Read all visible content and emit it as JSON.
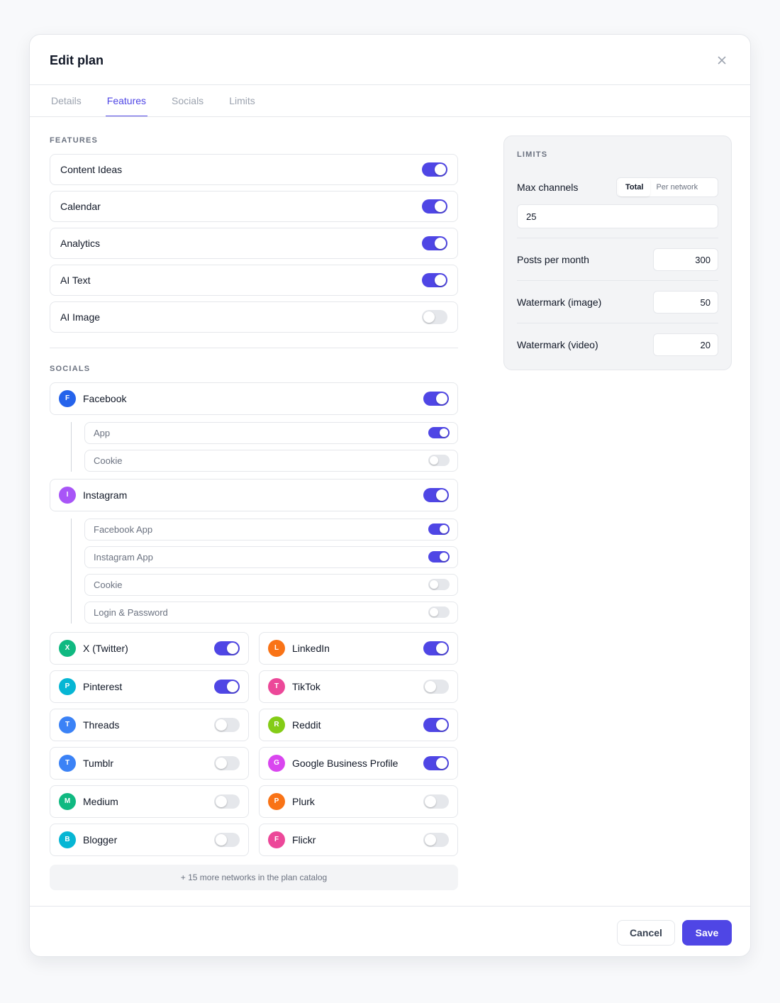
{
  "dialog": {
    "title": "Edit plan",
    "close_icon": "close-icon"
  },
  "tabs": [
    {
      "label": "Details",
      "active": false
    },
    {
      "label": "Features",
      "active": true
    },
    {
      "label": "Socials",
      "active": false
    },
    {
      "label": "Limits",
      "active": false
    }
  ],
  "features": {
    "section_label": "FEATURES",
    "items": [
      {
        "label": "Content Ideas",
        "enabled": true
      },
      {
        "label": "Calendar",
        "enabled": true
      },
      {
        "label": "Analytics",
        "enabled": true
      },
      {
        "label": "AI Text",
        "enabled": true
      },
      {
        "label": "AI Image",
        "enabled": false
      }
    ]
  },
  "socials": {
    "section_label": "SOCIALS",
    "expanded": [
      {
        "name": "Facebook",
        "initial": "F",
        "color": "#2563eb",
        "enabled": true,
        "methods": [
          {
            "label": "App",
            "enabled": true
          },
          {
            "label": "Cookie",
            "enabled": false
          }
        ]
      },
      {
        "name": "Instagram",
        "initial": "I",
        "color": "#a855f7",
        "enabled": true,
        "methods": [
          {
            "label": "Facebook App",
            "enabled": true
          },
          {
            "label": "Instagram App",
            "enabled": true
          },
          {
            "label": "Cookie",
            "enabled": false
          },
          {
            "label": "Login & Password",
            "enabled": false
          }
        ]
      }
    ],
    "grid": [
      {
        "name": "X (Twitter)",
        "initial": "X",
        "color": "#10b981",
        "enabled": true
      },
      {
        "name": "LinkedIn",
        "initial": "L",
        "color": "#f97316",
        "enabled": true
      },
      {
        "name": "Pinterest",
        "initial": "P",
        "color": "#06b6d4",
        "enabled": true
      },
      {
        "name": "TikTok",
        "initial": "T",
        "color": "#ec4899",
        "enabled": false
      },
      {
        "name": "Threads",
        "initial": "T",
        "color": "#3b82f6",
        "enabled": false
      },
      {
        "name": "Reddit",
        "initial": "R",
        "color": "#84cc16",
        "enabled": true
      },
      {
        "name": "Tumblr",
        "initial": "T",
        "color": "#3b82f6",
        "enabled": false
      },
      {
        "name": "Google Business Profile",
        "initial": "G",
        "color": "#d946ef",
        "enabled": true
      },
      {
        "name": "Medium",
        "initial": "M",
        "color": "#10b981",
        "enabled": false
      },
      {
        "name": "Plurk",
        "initial": "P",
        "color": "#f97316",
        "enabled": false
      },
      {
        "name": "Blogger",
        "initial": "B",
        "color": "#06b6d4",
        "enabled": false
      },
      {
        "name": "Flickr",
        "initial": "F",
        "color": "#ec4899",
        "enabled": false
      }
    ],
    "more_label": "+ 15 more networks in the plan catalog"
  },
  "limits": {
    "section_label": "LIMITS",
    "max_channels": {
      "label": "Max channels",
      "modes": [
        "Total",
        "Per network"
      ],
      "active_mode": "Total",
      "value": "25"
    },
    "fields": [
      {
        "label": "Posts per month",
        "value": "300"
      },
      {
        "label": "Watermark (image)",
        "value": "50"
      },
      {
        "label": "Watermark (video)",
        "value": "20"
      }
    ]
  },
  "footer": {
    "cancel_label": "Cancel",
    "save_label": "Save"
  },
  "colors": {
    "accent": "#4f46e5",
    "toggle_off": "#e5e7eb"
  }
}
